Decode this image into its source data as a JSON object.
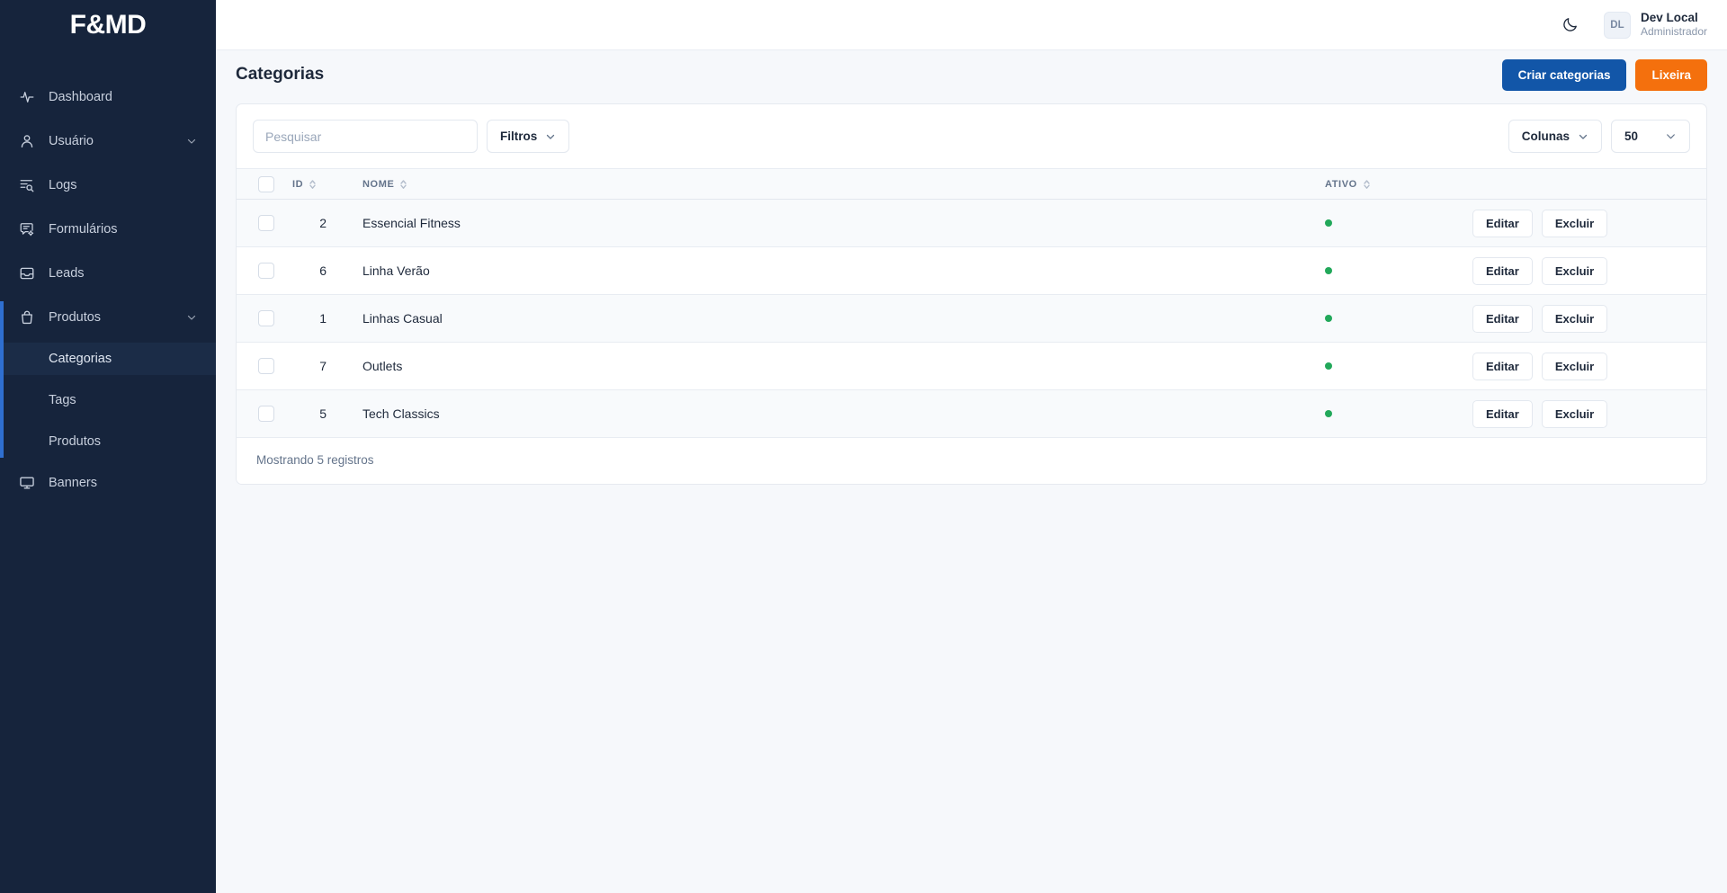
{
  "brand": {
    "logo_text": "F&MD"
  },
  "sidebar": {
    "items": [
      {
        "label": "Dashboard",
        "icon": "activity-icon",
        "expandable": false
      },
      {
        "label": "Usuário",
        "icon": "user-icon",
        "expandable": true
      },
      {
        "label": "Logs",
        "icon": "list-search-icon",
        "expandable": false
      },
      {
        "label": "Formulários",
        "icon": "message-cog-icon",
        "expandable": false
      },
      {
        "label": "Leads",
        "icon": "inbox-icon",
        "expandable": false
      },
      {
        "label": "Produtos",
        "icon": "shopping-bag-icon",
        "expandable": true
      },
      {
        "label": "Banners",
        "icon": "monitor-icon",
        "expandable": false
      }
    ],
    "produtos_submenu": [
      {
        "label": "Categorias",
        "current": true
      },
      {
        "label": "Tags",
        "current": false
      },
      {
        "label": "Produtos",
        "current": false
      }
    ],
    "accent_color": "#2f6fd0",
    "background_color": "#16243c"
  },
  "topbar": {
    "theme_toggle_icon": "moon-icon",
    "user": {
      "initials": "DL",
      "name": "Dev Local",
      "role": "Administrador"
    }
  },
  "page": {
    "title": "Categorias",
    "actions": [
      {
        "label": "Criar categorias",
        "style": "primary",
        "color": "#1256a8"
      },
      {
        "label": "Lixeira",
        "style": "danger",
        "color": "#f4700d"
      }
    ]
  },
  "toolbar": {
    "search_placeholder": "Pesquisar",
    "search_value": "",
    "filters_label": "Filtros",
    "columns_label": "Colunas",
    "page_size_value": "50"
  },
  "table": {
    "columns": [
      {
        "key": "check",
        "label": "",
        "sortable": false
      },
      {
        "key": "id",
        "label": "ID",
        "sortable": true
      },
      {
        "key": "nome",
        "label": "NOME",
        "sortable": true
      },
      {
        "key": "ativo",
        "label": "ATIVO",
        "sortable": true
      },
      {
        "key": "acoes",
        "label": "",
        "sortable": false
      }
    ],
    "rows": [
      {
        "id": "2",
        "nome": "Essencial Fitness",
        "ativo": true,
        "edit_label": "Editar",
        "delete_label": "Excluir"
      },
      {
        "id": "6",
        "nome": "Linha Verão",
        "ativo": true,
        "edit_label": "Editar",
        "delete_label": "Excluir"
      },
      {
        "id": "1",
        "nome": "Linhas Casual",
        "ativo": true,
        "edit_label": "Editar",
        "delete_label": "Excluir"
      },
      {
        "id": "7",
        "nome": "Outlets",
        "ativo": true,
        "edit_label": "Editar",
        "delete_label": "Excluir"
      },
      {
        "id": "5",
        "nome": "Tech Classics",
        "ativo": true,
        "edit_label": "Editar",
        "delete_label": "Excluir"
      }
    ],
    "footer_text": "Mostrando 5 registros",
    "active_dot_color": "#22a85a"
  }
}
